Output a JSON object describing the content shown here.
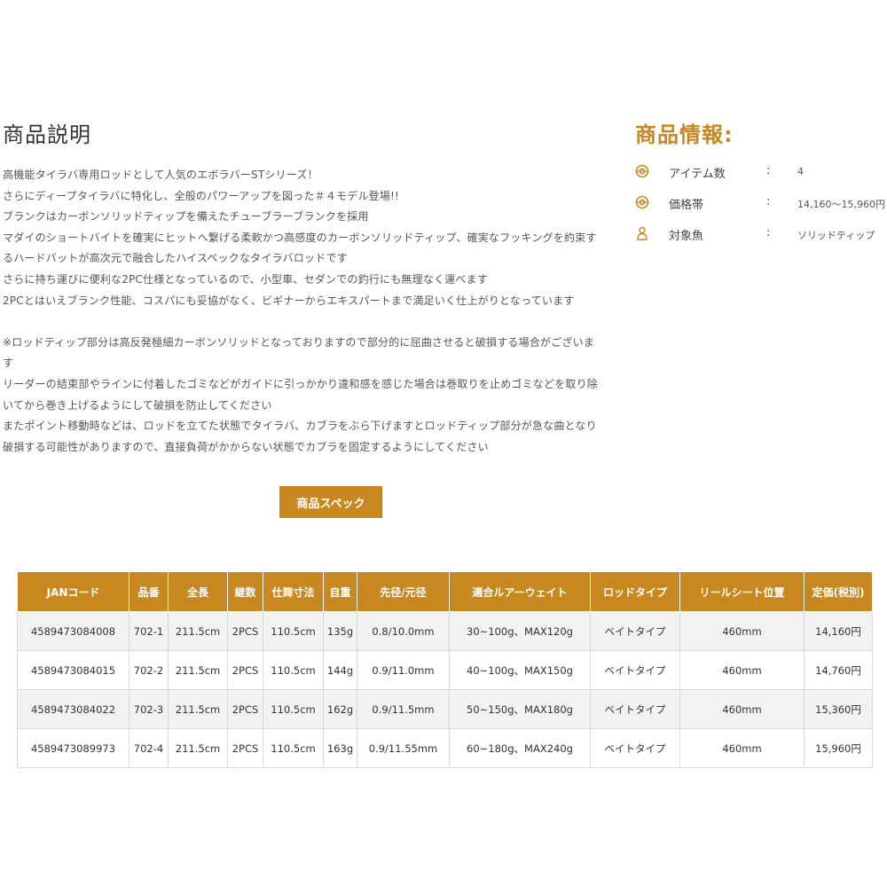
{
  "description": {
    "title": "商品説明",
    "paragraph1": [
      "高機能タイラバ専用ロッドとして人気のエボラバーSTシリーズ！",
      "さらにディープタイラバに特化し、全般のパワーアップを図った＃４モデル登場!!",
      "ブランクはカーボンソリッドティップを備えたチューブラーブランクを採用",
      "マダイのショートバイトを確実にヒットへ繋げる柔軟かつ高感度のカーボンソリッドティップ、確実なフッキングを約束す",
      "るハードバットが高次元で融合したハイスペックなタイラバロッドです",
      "さらに持ち運びに便利な2PC仕様となっているので、小型車、セダンでの釣行にも無理なく運べます",
      "2PCとはいえブランク性能、コスパにも妥協がなく、ビギナーからエキスパートまで満足いく仕上がりとなっています"
    ],
    "paragraph2": [
      "※ロッドティップ部分は高反発極細カーボンソリッドとなっておりますので部分的に屈曲させると破損する場合がございま",
      "す",
      "リーダーの結束部やラインに付着したゴミなどがガイドに引っかかり違和感を感じた場合は巻取りを止めゴミなどを取り除",
      "いてから巻き上げるようにして破損を防止してください",
      "またポイント移動時などは、ロッドを立てた状態でタイラバ、カブラをぶら下げますとロッドティップ部分が急な曲となり",
      "破損する可能性がありますので、直接負荷がかからない状態でカブラを固定するようにしてください"
    ]
  },
  "product_info": {
    "title": "商品情報:",
    "rows": [
      {
        "icon": "tag-icon",
        "label": "アイテム数",
        "colon": ":",
        "value": "4"
      },
      {
        "icon": "tag-icon",
        "label": "価格帯",
        "colon": ":",
        "value": "14,160～15,960円"
      },
      {
        "icon": "person-icon",
        "label": "対象魚",
        "colon": ":",
        "value": "ソリッドティップ"
      }
    ]
  },
  "spec_button": {
    "label": "商品スペック"
  },
  "spec_table": {
    "headers": [
      "JANコード",
      "品番",
      "全長",
      "継数",
      "仕舞寸法",
      "自重",
      "先径/元径",
      "適合ルアーウェイト",
      "ロッドタイプ",
      "リールシート位置",
      "定価(税別)"
    ],
    "rows": [
      [
        "4589473084008",
        "702-1",
        "211.5cm",
        "2PCS",
        "110.5cm",
        "135g",
        "0.8/10.0mm",
        "30~100g、MAX120g",
        "ベイトタイプ",
        "460mm",
        "14,160円"
      ],
      [
        "4589473084015",
        "702-2",
        "211.5cm",
        "2PCS",
        "110.5cm",
        "144g",
        "0.9/11.0mm",
        "40~100g、MAX150g",
        "ベイトタイプ",
        "460mm",
        "14,760円"
      ],
      [
        "4589473084022",
        "702-3",
        "211.5cm",
        "2PCS",
        "110.5cm",
        "162g",
        "0.9/11.5mm",
        "50~150g、MAX180g",
        "ベイトタイプ",
        "460mm",
        "15,360円"
      ],
      [
        "4589473089973",
        "702-4",
        "211.5cm",
        "2PCS",
        "110.5cm",
        "163g",
        "0.9/11.55mm",
        "60~180g、MAX240g",
        "ベイトタイプ",
        "460mm",
        "15,960円"
      ]
    ]
  },
  "colors": {
    "accent": "#c8871f",
    "row_alt": "#f2f2f2",
    "border": "#d9d9d9"
  }
}
